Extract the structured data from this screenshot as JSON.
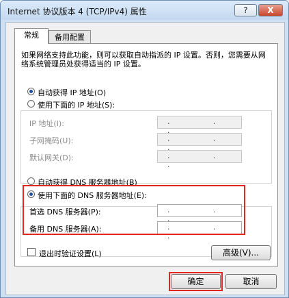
{
  "window": {
    "title": "Internet 协议版本 4 (TCP/IPv4) 属性",
    "help_label": "?",
    "close_label": "X"
  },
  "tabs": [
    {
      "label": "常规",
      "active": true
    },
    {
      "label": "备用配置",
      "active": false
    }
  ],
  "description": "如果网络支持此功能，则可以获取自动指派的 IP 设置。否则，您需要从网络系统管理员处获得适当的 IP 设置。",
  "ip": {
    "auto_label": "自动获得 IP 地址(O)",
    "manual_label": "使用下面的 IP 地址(S):",
    "selected": "auto",
    "fields": [
      {
        "label": "IP 地址(I):",
        "value": ". . ."
      },
      {
        "label": "子网掩码(U):",
        "value": ". . ."
      },
      {
        "label": "默认网关(D):",
        "value": ". . ."
      }
    ]
  },
  "dns": {
    "auto_label": "自动获得 DNS 服务器地址(B)",
    "manual_label": "使用下面的 DNS 服务器地址(E):",
    "selected": "manual",
    "fields": [
      {
        "label": "首选 DNS 服务器(P):",
        "value": ". . ."
      },
      {
        "label": "备用 DNS 服务器(A):",
        "value": ". . ."
      }
    ]
  },
  "validate_label": "退出时验证设置(L)",
  "advanced_label": "高级(V)...",
  "ok_label": "确定",
  "cancel_label": "取消",
  "colors": {
    "highlight": "#e0261e",
    "accent": "#1b4ea1"
  }
}
